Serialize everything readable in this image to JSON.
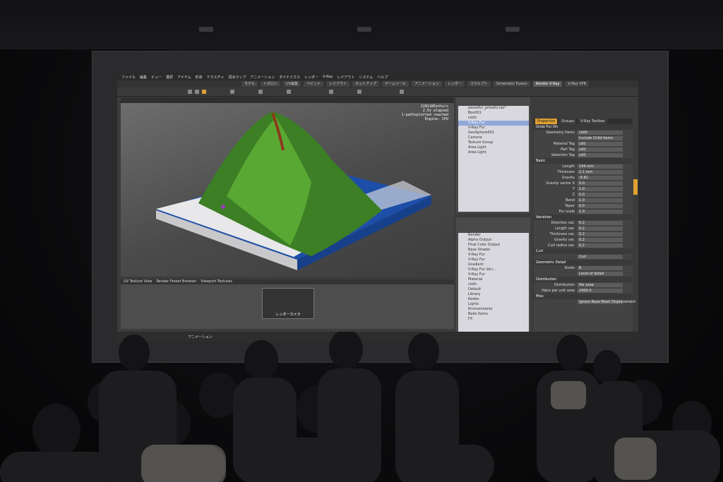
{
  "menubar": [
    "ファイル",
    "編集",
    "ビュー",
    "選択",
    "アイテム",
    "形状",
    "テクスチャ",
    "頂点マップ",
    "アニメーション",
    "ダイナミクス",
    "レンダー",
    "V-Ray",
    "レイアウト",
    "システム",
    "ヘルプ"
  ],
  "tabs": [
    {
      "label": "モデル",
      "active": false
    },
    {
      "label": "トポロジ",
      "active": false
    },
    {
      "label": "UV編集",
      "active": false
    },
    {
      "label": "ペイント",
      "active": false
    },
    {
      "label": "レイアウト",
      "active": false
    },
    {
      "label": "セットアップ",
      "active": false
    },
    {
      "label": "ゲームツール",
      "active": false
    },
    {
      "label": "アニメーション",
      "active": false
    },
    {
      "label": "レンダー",
      "active": false
    },
    {
      "label": "スカルプト",
      "active": false
    },
    {
      "label": "Schematic Fusion",
      "active": false
    },
    {
      "label": "Render V-Ray",
      "active": true
    },
    {
      "label": "V-Ray VFB",
      "active": false
    }
  ],
  "viewport": {
    "stats": [
      "22811KPaths/s",
      "2.5s elapsed",
      "1-pathsplatted reached",
      "Engine: CPU"
    ]
  },
  "outliner": {
    "items": [
      {
        "label": "passafur_presets.lxo*",
        "selected": false
      },
      {
        "label": "Box001",
        "selected": false
      },
      {
        "label": "cloth",
        "selected": false
      },
      {
        "label": "V-Ray Fur",
        "selected": true
      },
      {
        "label": "V-Ray Fur",
        "selected": false
      },
      {
        "label": "GeoSphere001",
        "selected": false
      },
      {
        "label": "Camera",
        "selected": false
      },
      {
        "label": "Texture Group",
        "selected": false
      },
      {
        "label": "Area Light",
        "selected": false
      },
      {
        "label": "Area Light",
        "selected": false
      }
    ]
  },
  "shader": {
    "items": [
      "Render",
      "Alpha Output",
      "Final Color Output",
      "Base Shader",
      "V-Ray Fur",
      "V-Ray Fur",
      "Gradient",
      "V-Ray Fur Vari...",
      "V-Ray Fur",
      "Material",
      "cloth",
      "Default",
      "Library",
      "Nodes",
      "Lights",
      "Environments",
      "Bake Items",
      "FX"
    ]
  },
  "properties": {
    "tabs": [
      {
        "label": "Properties",
        "active": true
      },
      {
        "label": "Groups",
        "active": false
      },
      {
        "label": "V-Ray Toolbox",
        "active": false
      }
    ],
    "rows": [
      {
        "section": "Grow Fur On"
      },
      {
        "label": "Geometry Items",
        "value": "cloth"
      },
      {
        "label": "",
        "value": "Include Child Items"
      },
      {
        "label": "Material Tag",
        "value": "(all)"
      },
      {
        "label": "Part Tag",
        "value": "(all)"
      },
      {
        "label": "Selection Tag",
        "value": "(all)"
      },
      {
        "section": "Basic"
      },
      {
        "label": "Length",
        "value": "144 mm"
      },
      {
        "label": "Thickness",
        "value": "2.1 mm"
      },
      {
        "label": "Gravity",
        "value": "-9.81"
      },
      {
        "label": "Gravity vector X",
        "value": "0.0"
      },
      {
        "label": "Y",
        "value": "1.0"
      },
      {
        "label": "Z",
        "value": "0.0"
      },
      {
        "label": "Bend",
        "value": "1.0"
      },
      {
        "label": "Taper",
        "value": "0.0"
      },
      {
        "label": "Fur scale",
        "value": "1.0"
      },
      {
        "section": "Variation"
      },
      {
        "label": "Direction var.",
        "value": "0.2"
      },
      {
        "label": "Length var.",
        "value": "0.2"
      },
      {
        "label": "Thickness var.",
        "value": "0.2"
      },
      {
        "label": "Gravity var.",
        "value": "0.2"
      },
      {
        "label": "Curl radius var.",
        "value": "0.2"
      },
      {
        "section": "Curl"
      },
      {
        "label": "",
        "value": "Curl"
      },
      {
        "section": "Geometric Detail"
      },
      {
        "label": "Knots",
        "value": "8"
      },
      {
        "label": "",
        "value": "Level of detail"
      },
      {
        "section": "Distribution"
      },
      {
        "label": "Distribution",
        "value": "Per area"
      },
      {
        "label": "Hairs per unit area",
        "value": "2400.0"
      },
      {
        "section": "Misc"
      },
      {
        "label": "",
        "value": "Ignore Base Mesh Displacement"
      }
    ]
  },
  "timeline": {
    "tabs": [
      "UV Texture View",
      "Render Preset Browser",
      "Viewport Textures"
    ],
    "thumb_label": "レンダーカメラ"
  },
  "statusbar": {
    "mode": "アニメーション"
  },
  "colors": {
    "accent": "#e0a030",
    "grass": "#4f9a2e",
    "water": "#1d4fa8",
    "snow": "#e8e8ea"
  }
}
